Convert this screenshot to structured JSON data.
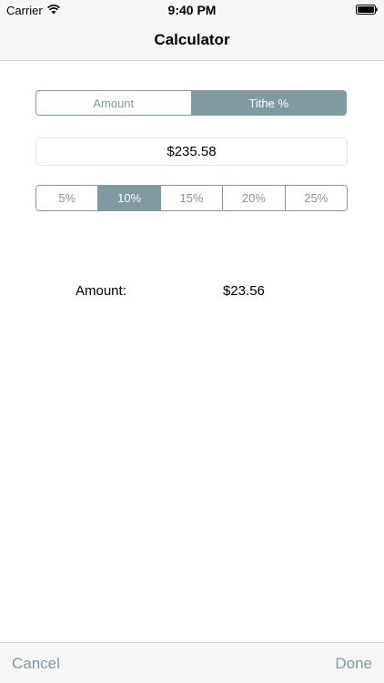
{
  "status_bar": {
    "carrier": "Carrier",
    "time": "9:40 PM"
  },
  "nav": {
    "title": "Calculator"
  },
  "mode": {
    "options": [
      "Amount",
      "Tithe %"
    ],
    "selected": "Tithe %"
  },
  "amount": {
    "value": "$235.58"
  },
  "percentages": {
    "options": [
      "5%",
      "10%",
      "15%",
      "20%",
      "25%"
    ],
    "selected": "10%"
  },
  "result": {
    "label": "Amount:",
    "value": "$23.56"
  },
  "toolbar": {
    "cancel_label": "Cancel",
    "done_label": "Done"
  },
  "colors": {
    "accent": "#7f9aa1",
    "bar_background": "#f7f7f7"
  }
}
